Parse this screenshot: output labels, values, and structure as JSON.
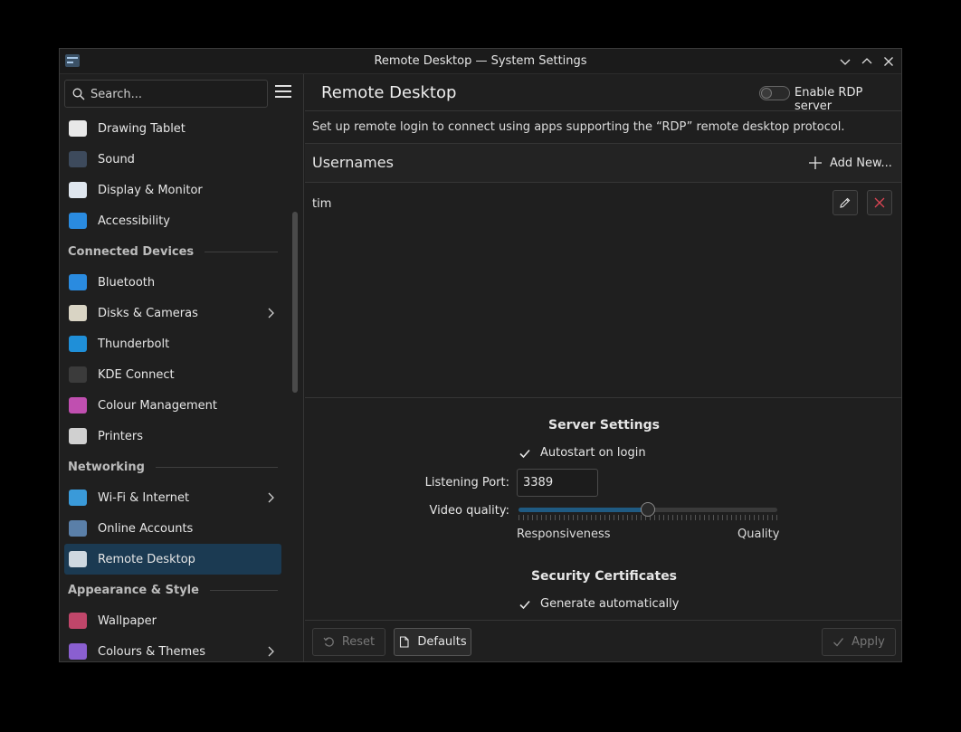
{
  "window": {
    "title": "Remote Desktop — System Settings"
  },
  "search": {
    "placeholder": "Search..."
  },
  "sidebar": {
    "items": [
      {
        "type": "item",
        "label": "Drawing Tablet",
        "icon": "drawing-tablet-icon",
        "color": "#e8e8e8"
      },
      {
        "type": "item",
        "label": "Sound",
        "icon": "sound-icon",
        "color": "#3d4a5c"
      },
      {
        "type": "item",
        "label": "Display & Monitor",
        "icon": "display-icon",
        "color": "#dfe6ee"
      },
      {
        "type": "item",
        "label": "Accessibility",
        "icon": "accessibility-icon",
        "color": "#2a8be0"
      },
      {
        "type": "section",
        "label": "Connected Devices"
      },
      {
        "type": "item",
        "label": "Bluetooth",
        "icon": "bluetooth-icon",
        "color": "#2a8be0"
      },
      {
        "type": "item",
        "label": "Disks & Cameras",
        "icon": "disks-icon",
        "color": "#d9d4c4",
        "chevron": true
      },
      {
        "type": "item",
        "label": "Thunderbolt",
        "icon": "thunderbolt-icon",
        "color": "#1f8fd8"
      },
      {
        "type": "item",
        "label": "KDE Connect",
        "icon": "kde-connect-icon",
        "color": "#3b3b3b"
      },
      {
        "type": "item",
        "label": "Colour Management",
        "icon": "colour-management-icon",
        "color": "#c04fb0"
      },
      {
        "type": "item",
        "label": "Printers",
        "icon": "printer-icon",
        "color": "#d0d0d0"
      },
      {
        "type": "section",
        "label": "Networking"
      },
      {
        "type": "item",
        "label": "Wi-Fi & Internet",
        "icon": "globe-icon",
        "color": "#3a9ad9",
        "chevron": true
      },
      {
        "type": "item",
        "label": "Online Accounts",
        "icon": "online-accounts-icon",
        "color": "#5a7fa8"
      },
      {
        "type": "item",
        "label": "Remote Desktop",
        "icon": "remote-desktop-icon",
        "color": "#cfd8e0",
        "active": true
      },
      {
        "type": "section",
        "label": "Appearance & Style"
      },
      {
        "type": "item",
        "label": "Wallpaper",
        "icon": "wallpaper-icon",
        "color": "#c0466a"
      },
      {
        "type": "item",
        "label": "Colours & Themes",
        "icon": "colours-themes-icon",
        "color": "#8a5fd0",
        "chevron": true
      }
    ]
  },
  "header": {
    "title": "Remote Desktop",
    "toggle_label": "Enable RDP server",
    "toggle_on": false
  },
  "description": "Set up remote login to connect using apps supporting the “RDP” remote desktop protocol.",
  "usernames": {
    "title": "Usernames",
    "add_label": "Add New...",
    "users": [
      "tim"
    ]
  },
  "server_settings": {
    "title": "Server Settings",
    "autostart_label": "Autostart on login",
    "autostart_checked": true,
    "port_label": "Listening Port:",
    "port_value": "3389",
    "video_label": "Video quality:",
    "video_value_fraction": 0.5,
    "slider_min_label": "Responsiveness",
    "slider_max_label": "Quality"
  },
  "security": {
    "title": "Security Certificates",
    "generate_label": "Generate automatically",
    "generate_checked": true
  },
  "footer": {
    "reset_label": "Reset",
    "defaults_label": "Defaults",
    "apply_label": "Apply"
  },
  "colors": {
    "accent": "#3daee9",
    "selection": "#1b3a52",
    "delete_red": "#da4453"
  }
}
